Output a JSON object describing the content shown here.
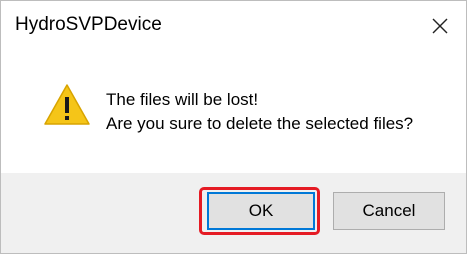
{
  "window": {
    "title": "HydroSVPDevice",
    "close_icon": "close-icon"
  },
  "message": {
    "icon": "warning-icon",
    "line1": "The files will be lost!",
    "line2": "Are you sure to delete the selected files?"
  },
  "buttons": {
    "ok_label": "OK",
    "cancel_label": "Cancel"
  },
  "colors": {
    "highlight": "#e51b24",
    "warning": "#f5c518",
    "footer_bg": "#f0f0f0",
    "focus_border": "#0078d7"
  }
}
